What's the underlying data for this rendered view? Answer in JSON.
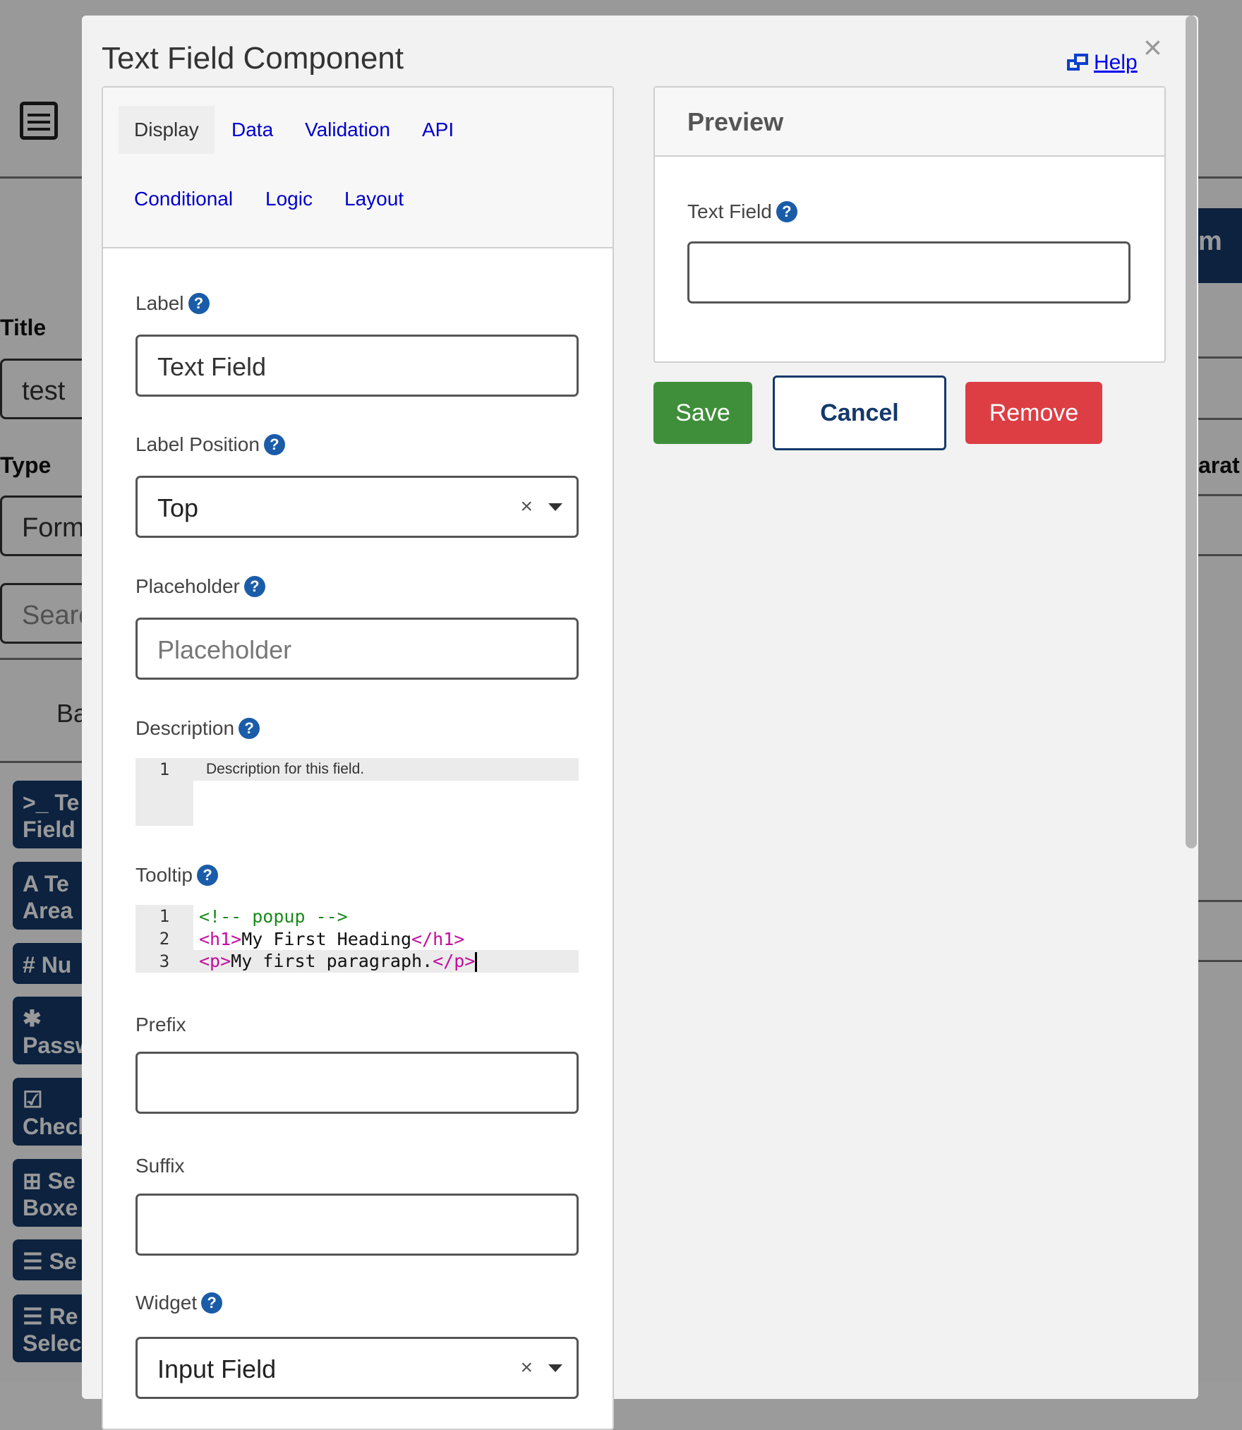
{
  "background": {
    "labels": {
      "title": "Title",
      "type": "Type",
      "separator": "arat"
    },
    "inputs": {
      "title_value": "test",
      "type_value": "Form",
      "search_placeholder": "Search"
    },
    "basic_tab": "Ba",
    "right_tab": "m",
    "component_buttons": [
      {
        "icon": ">_",
        "label": "Te\nField"
      },
      {
        "icon": "A",
        "label": "Te\nArea"
      },
      {
        "icon": "#",
        "label": "Nu"
      },
      {
        "icon": "✱",
        "label": "Passw"
      },
      {
        "icon": "☑",
        "label": "Checl"
      },
      {
        "icon": "⊞",
        "label": "Se\nBoxe"
      },
      {
        "icon": "☰",
        "label": "Se"
      },
      {
        "icon": "☰",
        "label": "Re\nSelec"
      }
    ]
  },
  "modal": {
    "title": "Text Field Component",
    "help_label": "Help",
    "close_label": "×",
    "tabs": [
      "Display",
      "Data",
      "Validation",
      "API",
      "Conditional",
      "Logic",
      "Layout"
    ],
    "active_tab": "Display",
    "fields": {
      "label": {
        "label": "Label",
        "value": "Text Field"
      },
      "label_position": {
        "label": "Label Position",
        "value": "Top"
      },
      "placeholder": {
        "label": "Placeholder",
        "placeholder": "Placeholder"
      },
      "description": {
        "label": "Description",
        "line_number": "1",
        "text": "Description for this field."
      },
      "tooltip": {
        "label": "Tooltip",
        "lines": [
          {
            "num": "1",
            "comment": "<!-- popup -->"
          },
          {
            "num": "2",
            "open": "<h1>",
            "text": "My First Heading",
            "close": "</h1>"
          },
          {
            "num": "3",
            "open": "<p>",
            "text": "My first paragraph.",
            "close": "</p>"
          }
        ]
      },
      "prefix": {
        "label": "Prefix",
        "value": ""
      },
      "suffix": {
        "label": "Suffix",
        "value": ""
      },
      "widget": {
        "label": "Widget",
        "value": "Input Field"
      }
    },
    "preview": {
      "title": "Preview",
      "field_label": "Text Field",
      "field_value": ""
    },
    "buttons": {
      "save": "Save",
      "cancel": "Cancel",
      "remove": "Remove"
    },
    "colors": {
      "save": "#3f8f3a",
      "cancel_border": "#14396a",
      "remove": "#dc3e44",
      "link": "#0000cc",
      "help_icon": "#1a5ca8"
    }
  }
}
